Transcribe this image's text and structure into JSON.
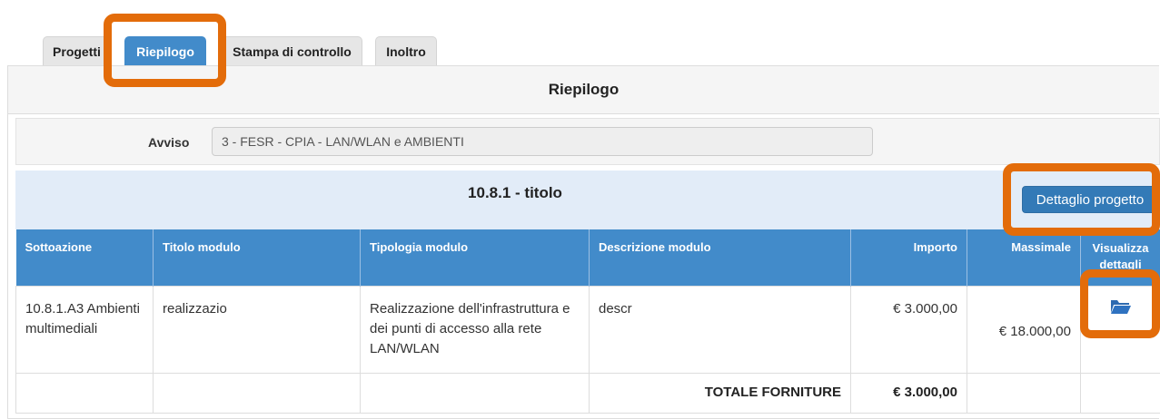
{
  "tabs": [
    {
      "label": "Progetti",
      "active": false
    },
    {
      "label": "Riepilogo",
      "active": true
    },
    {
      "label": "Stampa di controllo",
      "active": false
    },
    {
      "label": "Inoltro",
      "active": false
    }
  ],
  "panel": {
    "title": "Riepilogo"
  },
  "avviso": {
    "label": "Avviso",
    "value": "3 - FESR - CPIA - LAN/WLAN e AMBIENTI"
  },
  "section": {
    "title": "10.8.1 - titolo",
    "detail_button": "Dettaglio progetto"
  },
  "table": {
    "headers": [
      "Sottoazione",
      "Titolo modulo",
      "Tipologia modulo",
      "Descrizione modulo",
      "Importo",
      "Massimale",
      "Visualizza dettagli"
    ],
    "rows": [
      {
        "sottoazione": "10.8.1.A3 Ambienti multimediali",
        "titolo": "realizzazio",
        "tipologia": "Realizzazione dell'infrastruttura e dei punti di accesso alla rete LAN/WLAN",
        "descrizione": "descr",
        "importo": "€ 3.000,00",
        "massimale": "€ 18.000,00",
        "action_icon": "folder-open-icon"
      }
    ],
    "total": {
      "label": "TOTALE FORNITURE",
      "value": "€ 3.000,00"
    }
  },
  "colors": {
    "highlight": "#e36c0a",
    "accent": "#428bca",
    "button": "#337ab7"
  }
}
